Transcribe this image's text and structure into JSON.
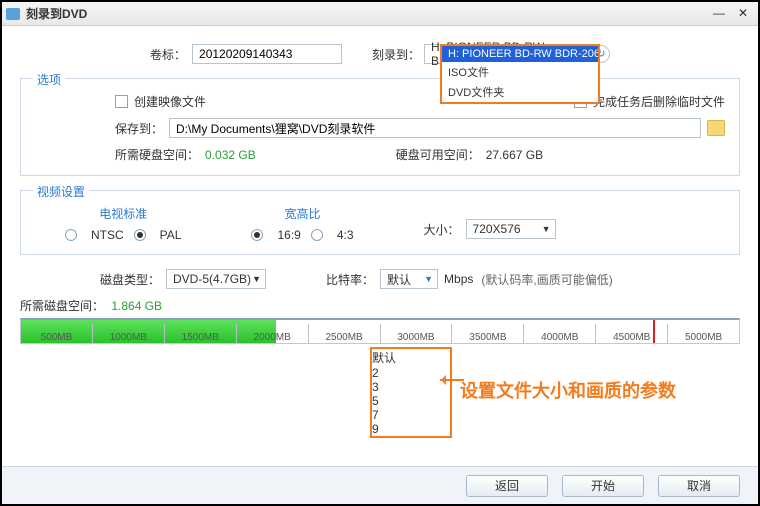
{
  "window": {
    "title": "刻录到DVD"
  },
  "row1": {
    "volume_label": "卷标：",
    "volume_value": "20120209140343",
    "burn_to_label": "刻录到：",
    "burn_to_value": "H: PIONEER  BD-RW  BDR-2..."
  },
  "burn_dropdown": {
    "opt0": "H: PIONEER  BD-RW  BDR-206",
    "opt1": "ISO文件",
    "opt2": "DVD文件夹"
  },
  "options": {
    "legend": "选项",
    "create_image": "创建映像文件",
    "delete_temp": "完成任务后删除临时文件",
    "save_to_label": "保存到：",
    "save_to_value": "D:\\My Documents\\狸窝\\DVD刻录软件",
    "need_label": "所需硬盘空间：",
    "need_value": "0.032 GB",
    "avail_label": "硬盘可用空间：",
    "avail_value": "27.667 GB"
  },
  "video": {
    "legend": "视频设置",
    "tv_label": "电视标准",
    "ntsc": "NTSC",
    "pal": "PAL",
    "aspect_label": "宽高比",
    "r169": "16:9",
    "r43": "4:3",
    "size_label": "大小：",
    "size_value": "720X576"
  },
  "disc": {
    "type_label": "磁盘类型：",
    "type_value": "DVD-5(4.7GB)",
    "bitrate_label": "比特率：",
    "bitrate_value": "默认",
    "unit": "Mbps",
    "hint": "(默认码率,画质可能偏低)"
  },
  "bitrate_dropdown": {
    "o0": "默认",
    "o1": "2",
    "o2": "3",
    "o3": "5",
    "o4": "7",
    "o5": "9"
  },
  "annotation": "设置文件大小和画质的参数",
  "space": {
    "label": "所需磁盘空间：",
    "value": "1.864 GB",
    "ticks": {
      "t0": "500MB",
      "t1": "1000MB",
      "t2": "1500MB",
      "t3": "2000MB",
      "t4": "2500MB",
      "t5": "3000MB",
      "t6": "3500MB",
      "t7": "4000MB",
      "t8": "4500MB",
      "t9": "5000MB"
    }
  },
  "buttons": {
    "back": "返回",
    "start": "开始",
    "cancel": "取消"
  }
}
